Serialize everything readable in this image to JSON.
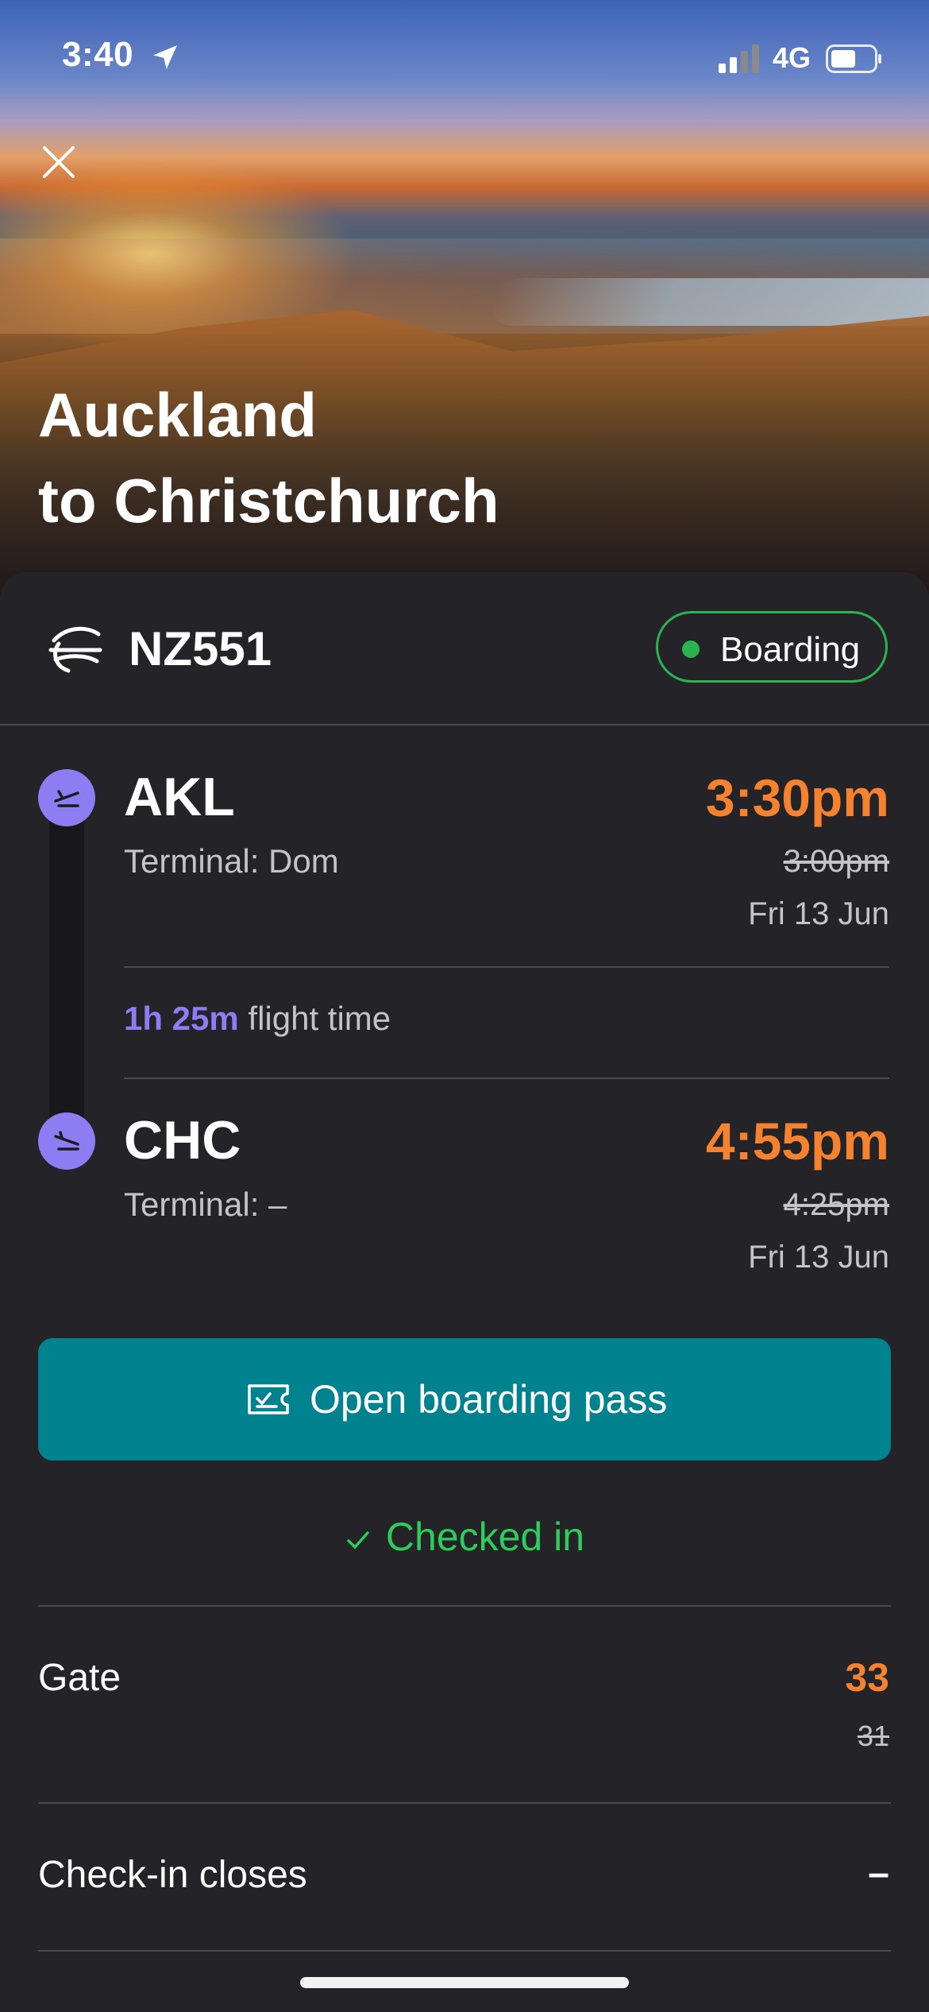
{
  "status_bar": {
    "time": "3:40",
    "network": "4G"
  },
  "route": {
    "line1": "Auckland",
    "line2": "to Christchurch"
  },
  "flight": {
    "number": "NZ551",
    "status": "Boarding"
  },
  "departure": {
    "code": "AKL",
    "terminal": "Terminal: Dom",
    "time_new": "3:30pm",
    "time_old": "3:00pm",
    "date": "Fri 13 Jun"
  },
  "duration": {
    "value": "1h 25m",
    "label": "flight time"
  },
  "arrival": {
    "code": "CHC",
    "terminal": "Terminal: –",
    "time_new": "4:55pm",
    "time_old": "4:25pm",
    "date": "Fri 13 Jun"
  },
  "actions": {
    "boarding_pass": "Open boarding pass",
    "checked_in": "Checked in"
  },
  "details": {
    "gate_label": "Gate",
    "gate_new": "33",
    "gate_old": "31",
    "checkin_label": "Check-in closes",
    "checkin_value": "–"
  },
  "colors": {
    "accent_orange": "#f5822f",
    "purple": "#8e7cf2",
    "teal": "#00838f",
    "green": "#2bb34f",
    "background": "#242328"
  },
  "icons": [
    "location-arrow-icon",
    "signal-icon",
    "battery-icon",
    "close-icon",
    "airline-logo-icon",
    "takeoff-icon",
    "landing-icon",
    "ticket-icon",
    "checkmark-icon"
  ]
}
